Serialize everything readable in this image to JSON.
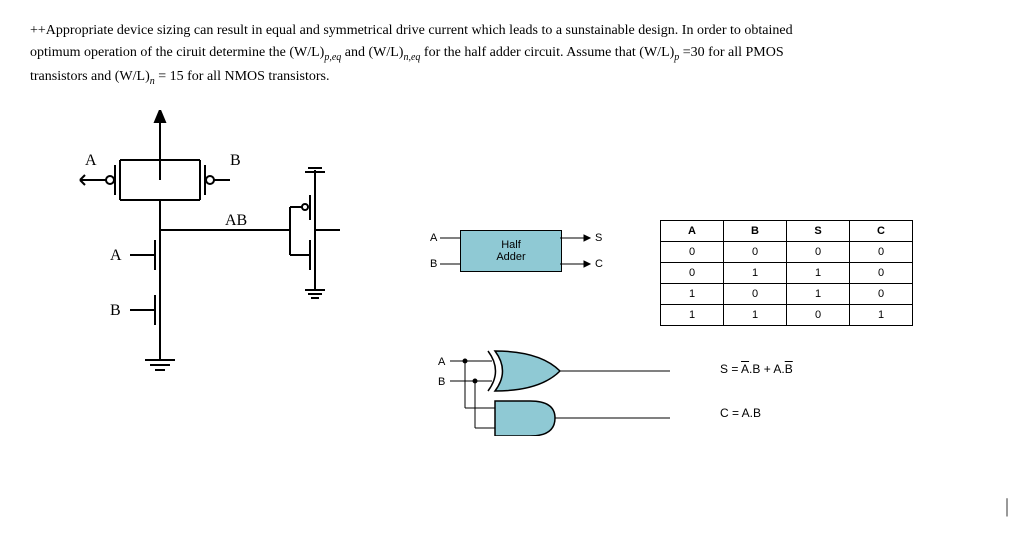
{
  "problem": {
    "line1_pre": "++Appropriate device sizing can result in equal and symmetrical drive current which leads to a sunstainable design. In order to obtained",
    "line2_pre": "optimum operation of the ciruit determine the ",
    "wl": "(W/L)",
    "sub_peq": "p,eq",
    "and_word": " and ",
    "sub_neq": "n,eq",
    "line2_post": " for the half adder circuit. Assume that ",
    "sub_p": "p",
    "val_p": "=30 for all PMOS",
    "line3_pre": "transistors and ",
    "sub_n": "n",
    "val_n": " = 15 for all NMOS transistors."
  },
  "circuit": {
    "label_A_top": "A",
    "label_B_top": "B",
    "label_AB": "AB",
    "label_A_mid": "A",
    "label_B_bot": "B"
  },
  "block": {
    "in_A": "A",
    "in_B": "B",
    "out_S": "S",
    "out_C": "C",
    "name1": "Half",
    "name2": "Adder"
  },
  "truth": {
    "headers": [
      "A",
      "B",
      "S",
      "C"
    ],
    "rows": [
      [
        "0",
        "0",
        "0",
        "0"
      ],
      [
        "0",
        "1",
        "1",
        "0"
      ],
      [
        "1",
        "0",
        "1",
        "0"
      ],
      [
        "1",
        "1",
        "0",
        "1"
      ]
    ]
  },
  "gates": {
    "in_A": "A",
    "in_B": "B",
    "eq_S_pre": "S = ",
    "eq_S_term1_a": "A",
    "eq_S_term1_dot": ".B + A.",
    "eq_S_term2_b": "B",
    "eq_C": "C = A.B"
  }
}
